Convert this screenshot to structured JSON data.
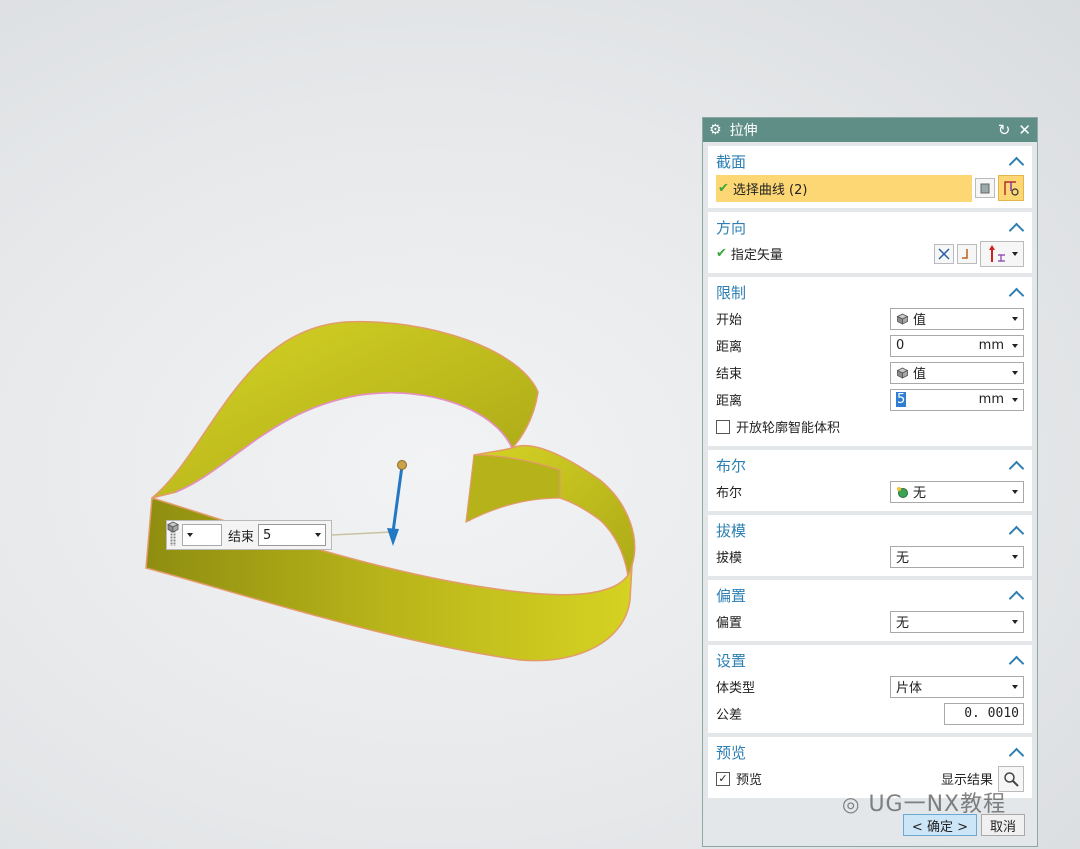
{
  "viewport": {
    "float_input": {
      "label": "结束",
      "value": "5"
    }
  },
  "dialog": {
    "title": "拉伸",
    "sections": {
      "section": {
        "title": "截面",
        "select_curve": "选择曲线 (2)"
      },
      "direction": {
        "title": "方向",
        "specify_vector": "指定矢量"
      },
      "limits": {
        "title": "限制",
        "start_label": "开始",
        "start_value": "值",
        "dist1_label": "距离",
        "dist1_value": "0",
        "dist1_unit": "mm",
        "end_label": "结束",
        "end_value": "值",
        "dist2_label": "距离",
        "dist2_value": "5",
        "dist2_unit": "mm",
        "open_profile": "开放轮廓智能体积"
      },
      "boolean": {
        "title": "布尔",
        "label": "布尔",
        "value": "无"
      },
      "draft": {
        "title": "拔模",
        "label": "拔模",
        "value": "无"
      },
      "offset": {
        "title": "偏置",
        "label": "偏置",
        "value": "无"
      },
      "settings": {
        "title": "设置",
        "body_type_label": "体类型",
        "body_type_value": "片体",
        "tolerance_label": "公差",
        "tolerance_value": "0. 0010"
      },
      "preview": {
        "title": "预览",
        "preview_label": "预览",
        "show_result": "显示结果"
      }
    },
    "buttons": {
      "ok": "< 确定 >",
      "cancel": "取消"
    }
  },
  "watermark": "UG一NX教程",
  "colors": {
    "accent": "#2d7fb3",
    "title_bar": "#5f8e87",
    "highlight": "#fdd774",
    "model": "#c8c41e"
  }
}
